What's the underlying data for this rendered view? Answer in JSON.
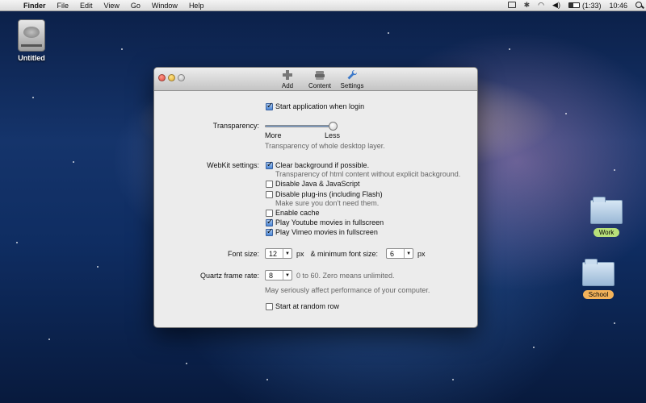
{
  "menubar": {
    "apple_glyph": "",
    "app_name": "Finder",
    "menus": [
      "File",
      "Edit",
      "View",
      "Go",
      "Window",
      "Help"
    ],
    "battery_text": "(1:33)",
    "clock": "10:46"
  },
  "desktop": {
    "drive_label": "Untitled",
    "folders": [
      {
        "label": "Work",
        "color": "#b8e07a"
      },
      {
        "label": "School",
        "color": "#f4b35a"
      }
    ]
  },
  "window": {
    "toolbar": {
      "add": "Add",
      "content": "Content",
      "settings": "Settings"
    },
    "start_when_login": {
      "label": "Start application when login",
      "checked": true
    },
    "transparency": {
      "label": "Transparency:",
      "min_label": "More",
      "max_label": "Less",
      "value_fraction": 1.0,
      "hint": "Transparency of  whole desktop layer."
    },
    "webkit": {
      "label": "WebKit settings:",
      "options": [
        {
          "label": "Clear background if possible.",
          "checked": true,
          "hint": "Transparency of html content without explicit background."
        },
        {
          "label": "Disable Java & JavaScript",
          "checked": false,
          "hint": ""
        },
        {
          "label": "Disable plug-ins (including Flash)",
          "checked": false,
          "hint": "Make sure you don't need them."
        },
        {
          "label": "Enable cache",
          "checked": false,
          "hint": ""
        },
        {
          "label": "Play Youtube movies in fullscreen",
          "checked": true,
          "hint": ""
        },
        {
          "label": "Play Vimeo movies in fullscreen",
          "checked": true,
          "hint": ""
        }
      ]
    },
    "font_size": {
      "label": "Font size:",
      "value": "12",
      "unit": "px",
      "min_label": "& minimum font size:",
      "min_value": "6",
      "min_unit": "px"
    },
    "quartz": {
      "label": "Quartz frame rate:",
      "value": "8",
      "range_hint": "0 to 60. Zero means unlimited.",
      "hint": "May seriously affect performance of your computer."
    },
    "random_row": {
      "label": "Start at random row",
      "checked": false
    }
  }
}
